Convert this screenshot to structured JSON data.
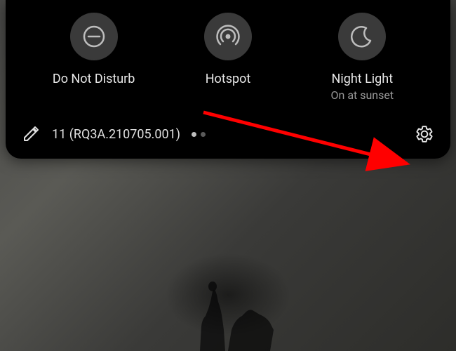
{
  "quicksettings": {
    "tiles": [
      {
        "label": "Do Not Disturb",
        "sublabel": "",
        "icon": "dnd"
      },
      {
        "label": "Hotspot",
        "sublabel": "",
        "icon": "hotspot"
      },
      {
        "label": "Night Light",
        "sublabel": "On at sunset",
        "icon": "nightlight"
      }
    ]
  },
  "footer": {
    "build_text": "11 (RQ3A.210705.001)",
    "page_index": 0,
    "page_count": 2
  },
  "colors": {
    "panel_bg": "#000000",
    "tile_bg": "#3a3a3a",
    "text_primary": "#e8e8e8",
    "text_secondary": "#9a9a9a",
    "arrow": "#ff0000"
  }
}
